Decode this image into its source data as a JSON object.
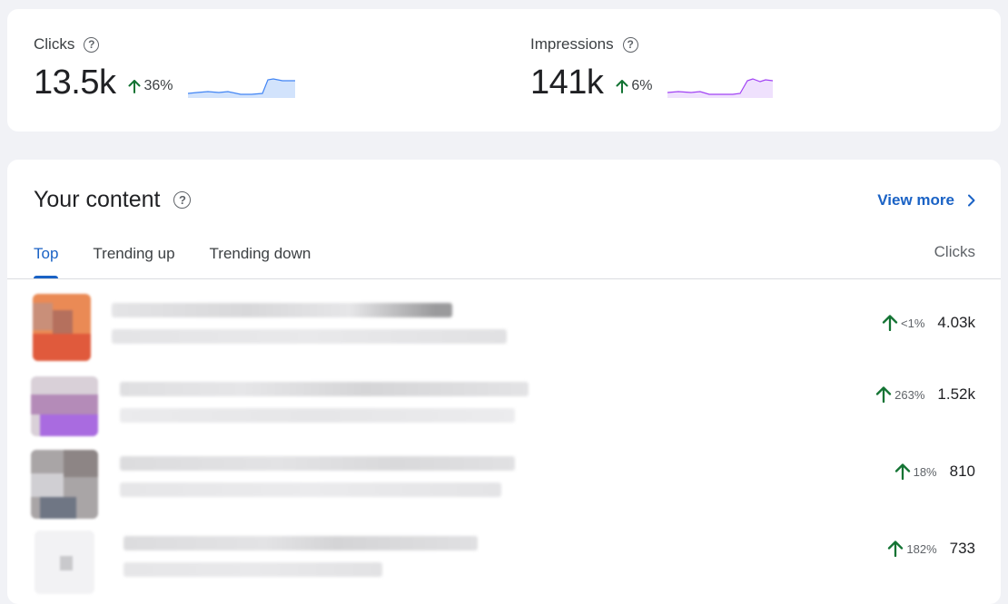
{
  "stats": {
    "clicks": {
      "label": "Clicks",
      "value": "13.5k",
      "change": "36%",
      "trend": "up"
    },
    "impressions": {
      "label": "Impressions",
      "value": "141k",
      "change": "6%",
      "trend": "up"
    }
  },
  "content": {
    "title": "Your content",
    "view_more": "View more",
    "tabs": [
      {
        "label": "Top",
        "active": true
      },
      {
        "label": "Trending up",
        "active": false
      },
      {
        "label": "Trending down",
        "active": false
      }
    ],
    "column_header": "Clicks",
    "rows": [
      {
        "change": "<1%",
        "clicks": "4.03k",
        "trend": "up"
      },
      {
        "change": "263%",
        "clicks": "1.52k",
        "trend": "up"
      },
      {
        "change": "18%",
        "clicks": "810",
        "trend": "up"
      },
      {
        "change": "182%",
        "clicks": "733",
        "trend": "up"
      }
    ]
  },
  "colors": {
    "accent": "#1a62c5",
    "trend_up": "#137333",
    "clicks_sparkline": "#4285f4",
    "impressions_sparkline": "#a142f4"
  },
  "icons": {
    "help": "help-circle-icon",
    "trend_up": "arrow-up-icon",
    "view_more": "chevron-right-icon"
  }
}
